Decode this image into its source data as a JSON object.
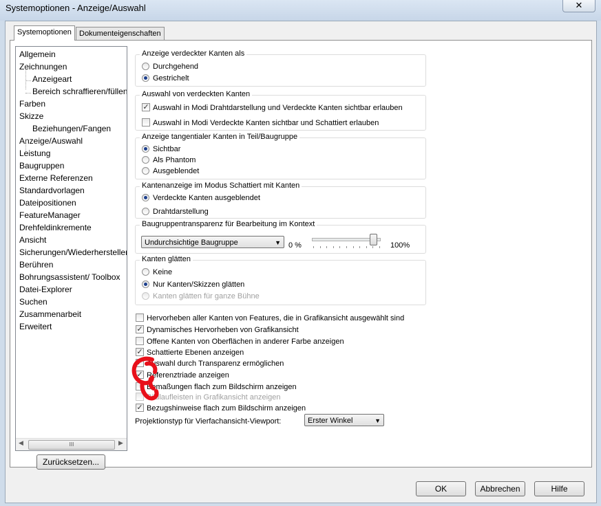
{
  "window": {
    "title": "Systemoptionen - Anzeige/Auswahl",
    "close_label": "✕"
  },
  "tabs": [
    "Systemoptionen",
    "Dokumenteigenschaften"
  ],
  "nav": {
    "items": [
      "Allgemein",
      "Zeichnungen",
      "Anzeigeart",
      "Bereich schraffieren/füllen",
      "Farben",
      "Skizze",
      "Beziehungen/Fangen",
      "Anzeige/Auswahl",
      "Leistung",
      "Baugruppen",
      "Externe Referenzen",
      "Standardvorlagen",
      "Dateipositionen",
      "FeatureManager",
      "Drehfeldinkremente",
      "Ansicht",
      "Sicherungen/Wiederherstellen",
      "Berühren",
      "Bohrungsassistent/ Toolbox",
      "Datei-Explorer",
      "Suchen",
      "Zusammenarbeit",
      "Erweitert"
    ],
    "scroll_grip": "III",
    "reset_button": "Zurücksetzen..."
  },
  "groups": {
    "hidden_edges": {
      "title": "Anzeige verdeckter Kanten als",
      "options": [
        "Durchgehend",
        "Gestrichelt"
      ],
      "selected": "Gestrichelt"
    },
    "hidden_selection": {
      "title": "Auswahl von verdeckten Kanten",
      "options": [
        "Auswahl in Modi Drahtdarstellung und Verdeckte Kanten sichtbar erlauben",
        "Auswahl in Modi Verdeckte Kanten sichtbar und Schattiert erlauben"
      ],
      "checked": [
        true,
        false
      ]
    },
    "tangent_edges": {
      "title": "Anzeige tangentialer Kanten in Teil/Baugruppe",
      "options": [
        "Sichtbar",
        "Als Phantom",
        "Ausgeblendet"
      ],
      "selected": "Sichtbar"
    },
    "shaded_edges": {
      "title": "Kantenanzeige im Modus Schattiert mit Kanten",
      "options": [
        "Verdeckte Kanten ausgeblendet",
        "Drahtdarstellung"
      ],
      "selected": "Verdeckte Kanten ausgeblendet"
    },
    "transparency": {
      "title": "Baugruppentransparenz für Bearbeitung im Kontext",
      "combo_value": "Undurchsichtige Baugruppe",
      "min_label": "0 %",
      "max_label": "100%",
      "slider_level_percent": 90
    },
    "smooth": {
      "title": "Kanten glätten",
      "options": [
        "Keine",
        "Nur Kanten/Skizzen glätten",
        "Kanten glätten für ganze Bühne"
      ],
      "selected": "Nur Kanten/Skizzen glätten",
      "disabled": [
        false,
        false,
        true
      ]
    }
  },
  "checkboxes": [
    {
      "label": "Hervorheben aller Kanten von Features, die in Grafikansicht ausgewählt sind",
      "checked": false,
      "disabled": false
    },
    {
      "label": "Dynamisches Hervorheben von Grafikansicht",
      "checked": true,
      "disabled": false
    },
    {
      "label": "Offene Kanten von Oberflächen in anderer Farbe anzeigen",
      "checked": false,
      "disabled": false
    },
    {
      "label": "Schattierte Ebenen anzeigen",
      "checked": true,
      "disabled": false
    },
    {
      "label": "Auswahl durch Transparenz ermöglichen",
      "checked": true,
      "disabled": false
    },
    {
      "label": "Referenztriade anzeigen",
      "checked": true,
      "disabled": false
    },
    {
      "label": "Bemaßungen flach zum Bildschirm anzeigen",
      "checked": false,
      "disabled": false
    },
    {
      "label": "Bildlaufleisten in Grafikansicht anzeigen",
      "checked": false,
      "disabled": true
    },
    {
      "label": "Bezugshinweise flach zum Bildschirm anzeigen",
      "checked": true,
      "disabled": false
    }
  ],
  "projection": {
    "label": "Projektionstyp für Vierfachansicht-Viewport:",
    "value": "Erster Winkel"
  },
  "footer": {
    "ok": "OK",
    "cancel": "Abbrechen",
    "help": "Hilfe"
  },
  "annotation_color": "#e8101a"
}
